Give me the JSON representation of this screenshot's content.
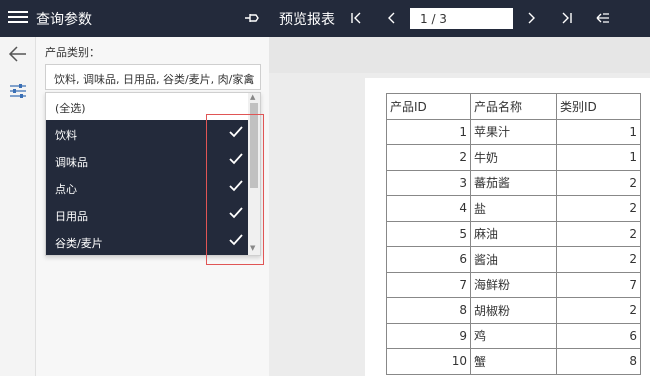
{
  "header": {
    "title": "查询参数",
    "preview_label": "预览报表",
    "page_value": "1 / 3"
  },
  "nav": {
    "first": "|◁",
    "prev": "‹",
    "next": "›",
    "last": "▷|"
  },
  "panel": {
    "param_label": "产品类别：",
    "selected_text": "饮料, 调味品, 日用品, 谷类/麦片, 肉/家禽",
    "select_arrow": "︿",
    "options": [
      {
        "label": "(全选)",
        "selected": false
      },
      {
        "label": "饮料",
        "selected": true
      },
      {
        "label": "调味品",
        "selected": true
      },
      {
        "label": "点心",
        "selected": true
      },
      {
        "label": "日用品",
        "selected": true
      },
      {
        "label": "谷类/麦片",
        "selected": true
      }
    ]
  },
  "report": {
    "columns": [
      "产品ID",
      "产品名称",
      "类别ID"
    ],
    "rows": [
      [
        1,
        "苹果汁",
        1
      ],
      [
        2,
        "牛奶",
        1
      ],
      [
        3,
        "蕃茄酱",
        2
      ],
      [
        4,
        "盐",
        2
      ],
      [
        5,
        "麻油",
        2
      ],
      [
        6,
        "酱油",
        2
      ],
      [
        7,
        "海鲜粉",
        7
      ],
      [
        8,
        "胡椒粉",
        2
      ],
      [
        9,
        "鸡",
        6
      ],
      [
        10,
        "蟹",
        8
      ]
    ]
  },
  "colors": {
    "topbar": "#232a3b",
    "selected_item": "#232a3b",
    "highlight": "#e05555"
  },
  "icons": {
    "menu": "menu-icon",
    "pin": "pin-icon",
    "back": "arrow-left-icon",
    "filters": "sliders-icon",
    "check": "check-icon",
    "collapse": "collapse-panel-icon"
  }
}
